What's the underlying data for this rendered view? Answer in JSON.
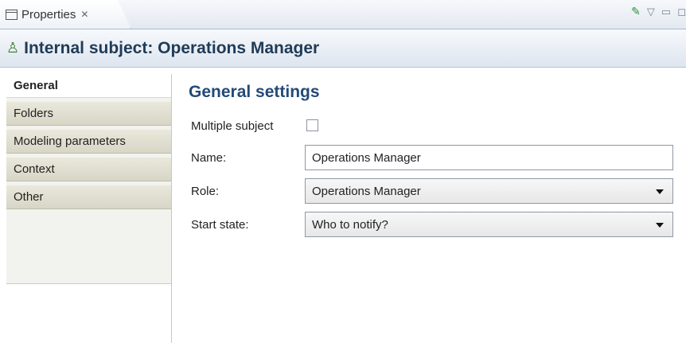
{
  "tab": {
    "label": "Properties",
    "close_glyph": "✕"
  },
  "toolbar_icons": [
    "pin-icon",
    "view-menu-icon",
    "minimize-icon",
    "maximize-icon"
  ],
  "header": {
    "title": "Internal subject: Operations Manager"
  },
  "nav": {
    "items": [
      {
        "label": "General",
        "active": true
      },
      {
        "label": "Folders",
        "active": false
      },
      {
        "label": "Modeling parameters",
        "active": false
      },
      {
        "label": "Context",
        "active": false
      },
      {
        "label": "Other",
        "active": false
      }
    ]
  },
  "general": {
    "title": "General settings",
    "multiple_subject": {
      "label": "Multiple subject",
      "checked": false
    },
    "name": {
      "label": "Name:",
      "value": "Operations Manager"
    },
    "role": {
      "label": "Role:",
      "value": "Operations Manager"
    },
    "start_state": {
      "label": "Start state:",
      "value": "Who to notify?"
    }
  }
}
